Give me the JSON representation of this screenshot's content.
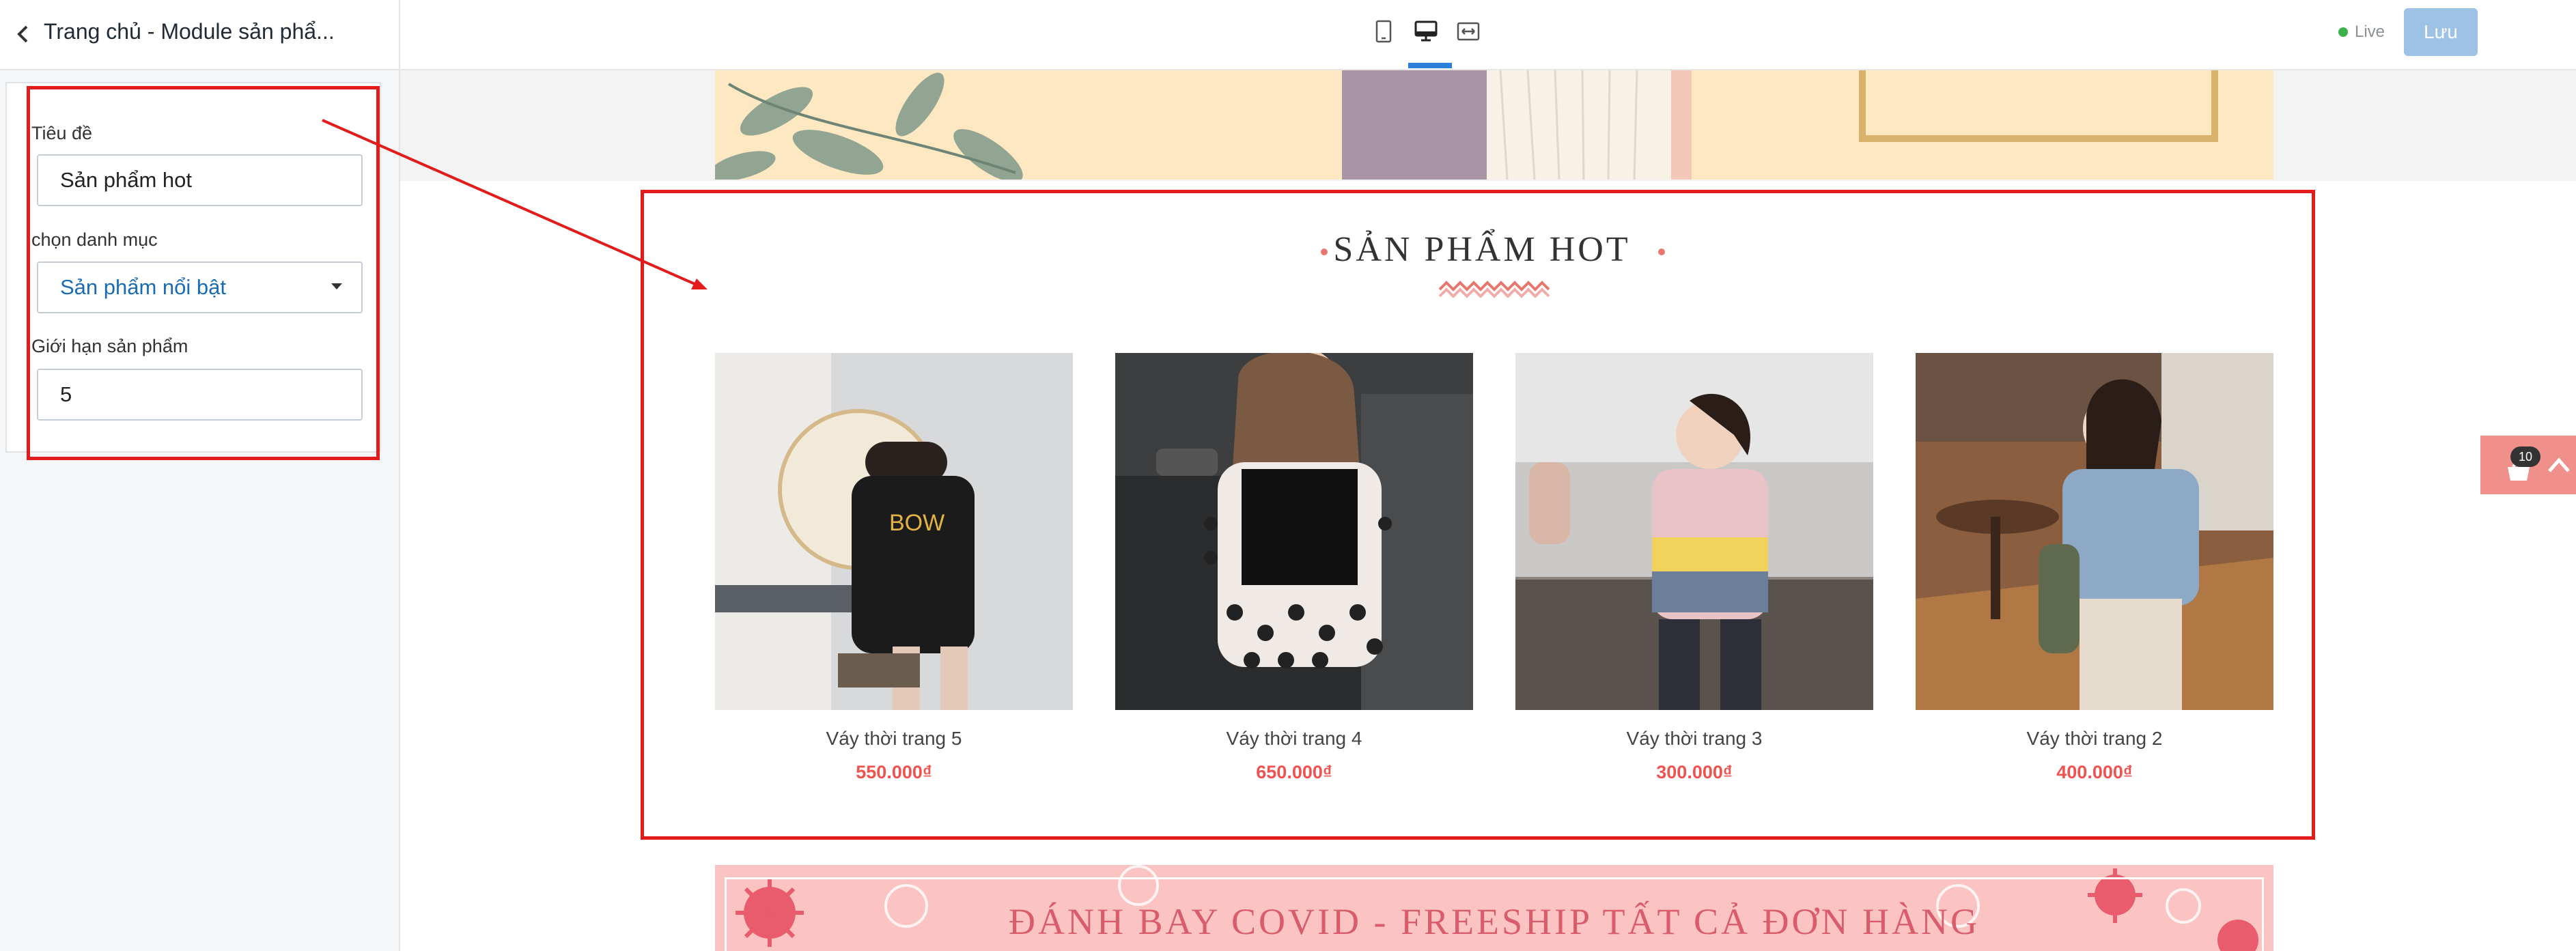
{
  "header": {
    "title": "Trang chủ - Module sản phẩ...",
    "devices": [
      "mobile-icon",
      "desktop-icon",
      "fullwidth-icon"
    ],
    "live_label": "Live",
    "save_label": "Lưu"
  },
  "settings": {
    "title_label": "Tiêu đề",
    "title_value": "Sản phẩm hot",
    "category_label": "chọn danh mục",
    "category_value": "Sản phẩm nổi bật",
    "limit_label": "Giới hạn sản phẩm",
    "limit_value": "5"
  },
  "section": {
    "title": "SẢN PHẨM HOT"
  },
  "products": [
    {
      "name": "Váy thời trang 5",
      "price": "550.000₫"
    },
    {
      "name": "Váy thời trang 4",
      "price": "650.000₫"
    },
    {
      "name": "Váy thời trang 3",
      "price": "300.000₫"
    },
    {
      "name": "Váy thời trang 2",
      "price": "400.000₫"
    }
  ],
  "promo": {
    "text": "ĐÁNH BAY COVID - FREESHIP TẤT CẢ ĐƠN HÀNG"
  },
  "cart": {
    "count": "10"
  },
  "colors": {
    "annotation": "#e21b1b",
    "price": "#ef5350",
    "accent": "#2a7fd8",
    "save_button": "#9dc2e6"
  }
}
